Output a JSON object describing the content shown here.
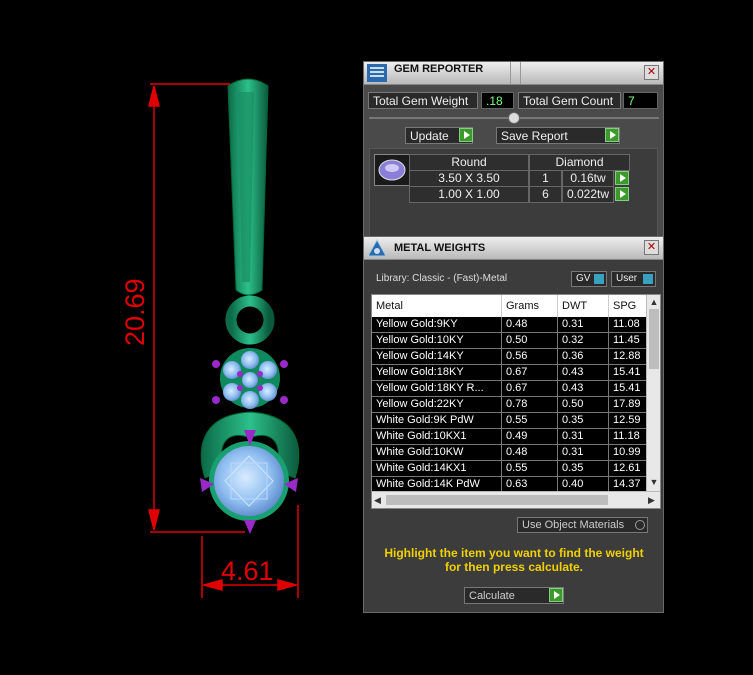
{
  "dimensions": {
    "height": "20.69",
    "width": "4.61",
    "line_color": "#e00000"
  },
  "gem_reporter": {
    "title": "GEM REPORTER",
    "total_gem_weight_label": "Total Gem Weight",
    "total_gem_weight_value": ".18",
    "total_gem_count_label": "Total Gem Count",
    "total_gem_count_value": "7",
    "update_label": "Update",
    "save_report_label": "Save Report",
    "gem_header": {
      "shape": "Round",
      "type": "Diamond"
    },
    "gems": [
      {
        "size": "3.50 X 3.50",
        "count": "1",
        "weight": "0.16tw"
      },
      {
        "size": "1.00 X 1.00",
        "count": "6",
        "weight": "0.022tw"
      }
    ]
  },
  "metal_weights": {
    "title": "METAL WEIGHTS",
    "library_label": "Library: Classic - (Fast)-Metal",
    "gv_label": "GV",
    "user_label": "User",
    "columns": [
      "Metal",
      "Grams",
      "DWT",
      "SPG"
    ],
    "rows": [
      [
        "Yellow Gold:9KY",
        "0.48",
        "0.31",
        "11.08"
      ],
      [
        "Yellow Gold:10KY",
        "0.50",
        "0.32",
        "11.45"
      ],
      [
        "Yellow Gold:14KY",
        "0.56",
        "0.36",
        "12.88"
      ],
      [
        "Yellow Gold:18KY",
        "0.67",
        "0.43",
        "15.41"
      ],
      [
        "Yellow Gold:18KY R...",
        "0.67",
        "0.43",
        "15.41"
      ],
      [
        "Yellow Gold:22KY",
        "0.78",
        "0.50",
        "17.89"
      ],
      [
        "White Gold:9K PdW",
        "0.55",
        "0.35",
        "12.59"
      ],
      [
        "White Gold:10KX1",
        "0.49",
        "0.31",
        "11.18"
      ],
      [
        "White Gold:10KW",
        "0.48",
        "0.31",
        "10.99"
      ],
      [
        "White Gold:14KX1",
        "0.55",
        "0.35",
        "12.61"
      ],
      [
        "White Gold:14K PdW",
        "0.63",
        "0.40",
        "14.37"
      ]
    ],
    "use_object_materials_label": "Use Object Materials",
    "instruction_line1": "Highlight the item you want to find the weight",
    "instruction_line2": "for then press calculate.",
    "calculate_label": "Calculate"
  }
}
